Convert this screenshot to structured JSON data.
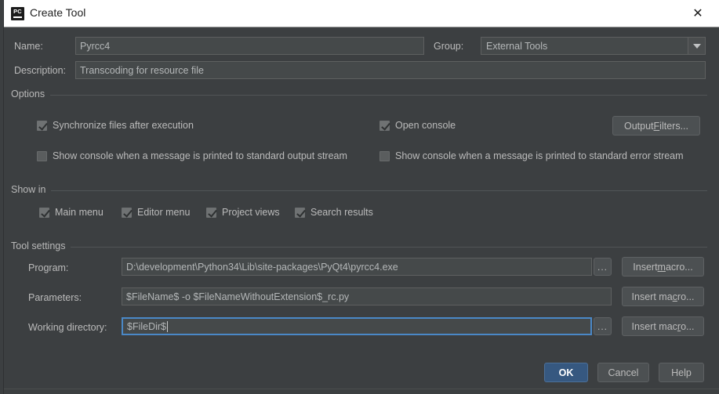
{
  "window": {
    "title": "Create Tool",
    "icon": "pycharm-icon",
    "close_label": "✕"
  },
  "form": {
    "name_label": "Name:",
    "name_value": "Pyrcc4",
    "group_label": "Group:",
    "group_value": "External Tools",
    "description_label": "Description:",
    "description_value": "Transcoding for resource file"
  },
  "options": {
    "section_title": "Options",
    "checkboxes": [
      {
        "label": "Synchronize files after execution",
        "checked": true
      },
      {
        "label": "Open console",
        "checked": true
      },
      {
        "label": "Show console when a message is printed to standard output stream",
        "checked": false
      },
      {
        "label": "Show console when a message is printed to standard error stream",
        "checked": false
      }
    ],
    "output_filters_button": "Output Filters...",
    "output_filters_pre": "Output ",
    "output_filters_mnemonic": "F",
    "output_filters_post": "ilters..."
  },
  "show_in": {
    "section_title": "Show in",
    "checkboxes": [
      {
        "label": "Main menu",
        "checked": true
      },
      {
        "label": "Editor menu",
        "checked": true
      },
      {
        "label": "Project views",
        "checked": true
      },
      {
        "label": "Search results",
        "checked": true
      }
    ]
  },
  "tool_settings": {
    "section_title": "Tool settings",
    "program_label": "Program:",
    "program_value": "D:\\development\\Python34\\Lib\\site-packages\\PyQt4\\pyrcc4.exe",
    "parameters_label": "Parameters:",
    "parameters_value": "$FileName$ -o $FileNameWithoutExtension$_rc.py",
    "working_directory_label": "Working directory:",
    "working_directory_value": "$FileDir$",
    "browse_label": "...",
    "insert_macro_pre": "Insert ",
    "insert_macro_buttons": [
      {
        "pre": "Insert ",
        "mnemonic": "m",
        "post": "acro..."
      },
      {
        "pre": "Insert ma",
        "mnemonic": "c",
        "post": "ro..."
      },
      {
        "pre": "Insert mac",
        "mnemonic": "r",
        "post": "o..."
      }
    ]
  },
  "footer": {
    "ok_label": "OK",
    "cancel_label": "Cancel",
    "help_label": "Help"
  },
  "colors": {
    "background": "#3c3f41",
    "field_background": "#45494a",
    "focus_border": "#4a88c7",
    "default_button": "#365880",
    "titlebar": "#ffffff"
  }
}
